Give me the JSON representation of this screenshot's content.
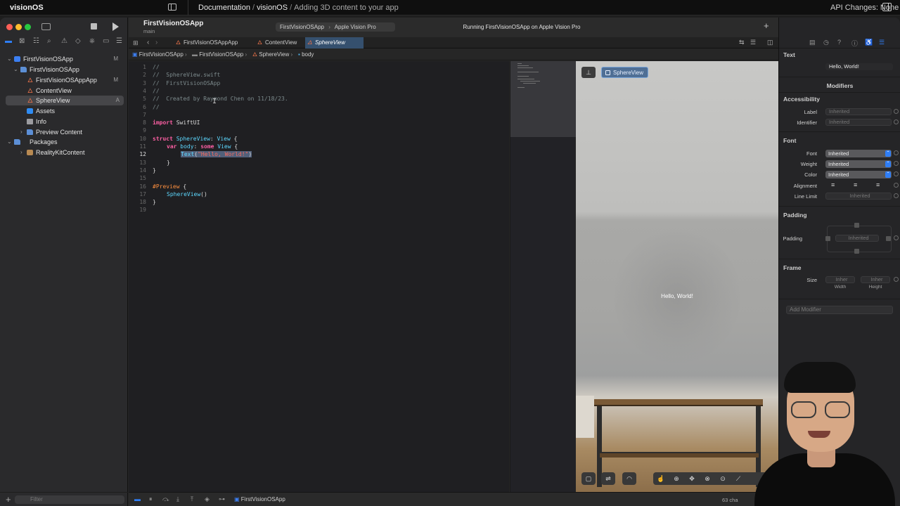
{
  "docbar": {
    "brand": "visionOS",
    "crumbs": [
      "Documentation",
      "visionOS",
      "Adding 3D content to your app"
    ],
    "api_changes": "API Changes: None"
  },
  "toolbar": {
    "project": "FirstVisionOSApp",
    "branch": "main",
    "scheme": "FirstVisionOSApp",
    "device": "Apple Vision Pro",
    "status": "Running FirstVisionOSApp on Apple Vision Pro"
  },
  "navigator": {
    "items": [
      {
        "label": "FirstVisionOSApp",
        "badge": "M",
        "type": "project"
      },
      {
        "label": "FirstVisionOSApp",
        "badge": "",
        "type": "folder"
      },
      {
        "label": "FirstVisionOSAppApp",
        "badge": "M",
        "type": "swift"
      },
      {
        "label": "ContentView",
        "badge": "",
        "type": "swift"
      },
      {
        "label": "SphereView",
        "badge": "A",
        "type": "swift"
      },
      {
        "label": "Assets",
        "badge": "",
        "type": "assets"
      },
      {
        "label": "Info",
        "badge": "",
        "type": "info"
      },
      {
        "label": "Preview Content",
        "badge": "",
        "type": "folder"
      },
      {
        "label": "Packages",
        "badge": "",
        "type": "folder"
      },
      {
        "label": "RealityKitContent",
        "badge": "",
        "type": "package"
      }
    ],
    "filter_placeholder": "Filter"
  },
  "tabs": [
    {
      "label": "FirstVisionOSAppApp"
    },
    {
      "label": "ContentView"
    },
    {
      "label": "SphereView",
      "active": true
    }
  ],
  "jumpbar": [
    "FirstVisionOSApp",
    "FirstVisionOSApp",
    "SphereView",
    "body"
  ],
  "editor": {
    "current_line": 12,
    "line_numbers": [
      "1",
      "2",
      "3",
      "4",
      "5",
      "6",
      "7",
      "8",
      "9",
      "10",
      "11",
      "12",
      "13",
      "14",
      "15",
      "16",
      "17",
      "18",
      "19"
    ],
    "tokens": {
      "l1": "//",
      "l2": "//  SphereView.swift",
      "l3": "//  FirstVisionOSApp",
      "l4": "//",
      "l5": "//  Created by Raymond Chen on 11/18/23.",
      "l6": "//",
      "l8_kw": "import",
      "l8_rest": " SwiftUI",
      "l10_kw": "struct",
      "l10_type": " SphereView",
      "l10_colon": ": ",
      "l10_proto": "View",
      "l10_brace": " {",
      "l11_kw": "var",
      "l11_name": " body",
      "l11_colon": ": ",
      "l11_some": "some",
      "l11_view": " View",
      "l11_brace": " {",
      "l12_type": "Text",
      "l12_open": "(",
      "l12_str": "\"Hello, World!\"",
      "l12_close": ")",
      "l13": "}",
      "l14": "}",
      "l16_macro": "#Preview",
      "l16_brace": " {",
      "l17_call": "SphereView",
      "l17_paren": "()",
      "l18": "}"
    }
  },
  "preview": {
    "selected_view": "SphereView",
    "rendered_text": "Hello, World!"
  },
  "inspector": {
    "text_section": "Text",
    "text_value": "Hello, World!",
    "modifiers_title": "Modifiers",
    "accessibility": {
      "title": "Accessibility",
      "label_lbl": "Label",
      "label_ph": "Inherited",
      "identifier_lbl": "Identifier",
      "identifier_ph": "Inherited"
    },
    "font": {
      "title": "Font",
      "font_lbl": "Font",
      "font_val": "Inherited",
      "weight_lbl": "Weight",
      "weight_val": "Inherited",
      "color_lbl": "Color",
      "color_val": "Inherited",
      "alignment_lbl": "Alignment",
      "linelimit_lbl": "Line Limit",
      "linelimit_val": "Inherited"
    },
    "padding": {
      "title": "Padding",
      "lbl": "Padding",
      "val": "Inherited"
    },
    "frame": {
      "title": "Frame",
      "size_lbl": "Size",
      "width_val": "Inher",
      "height_val": "Inher",
      "width_cap": "Width",
      "height_cap": "Height"
    },
    "add_modifier_ph": "Add Modifier"
  },
  "statusbar": {
    "project": "FirstVisionOSApp",
    "chars": "63 cha"
  },
  "colors": {
    "accent": "#2f7ef6",
    "keyword": "#fc5fa3",
    "type": "#5dd8ff",
    "string": "#fc6a5d",
    "comment": "#7c8a8c",
    "swift_icon": "#f0744a"
  }
}
